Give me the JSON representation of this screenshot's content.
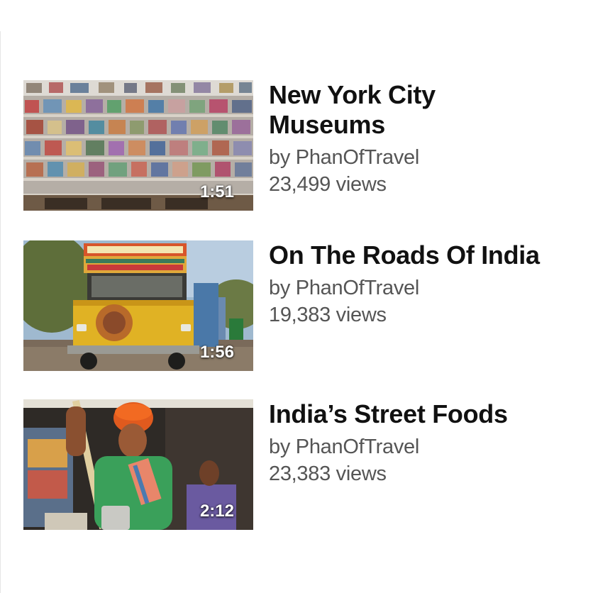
{
  "videos": [
    {
      "title_line1": "New York City",
      "title_line2": "Museums",
      "channel": "by PhanOfTravel",
      "views": "23,499 views",
      "duration": "1:51",
      "thumbnail": "museum-shelves"
    },
    {
      "title_line1": "On The Roads Of India",
      "channel": "by PhanOfTravel",
      "views": "19,383 views",
      "duration": "1:56",
      "thumbnail": "yellow-truck"
    },
    {
      "title_line1": "India’s Street Foods",
      "channel": "by PhanOfTravel",
      "views": "23,383 views",
      "duration": "2:12",
      "thumbnail": "street-vendor"
    }
  ],
  "colors": {
    "title": "#111111",
    "meta": "#555555",
    "duration": "#ffffff",
    "background": "#ffffff"
  }
}
